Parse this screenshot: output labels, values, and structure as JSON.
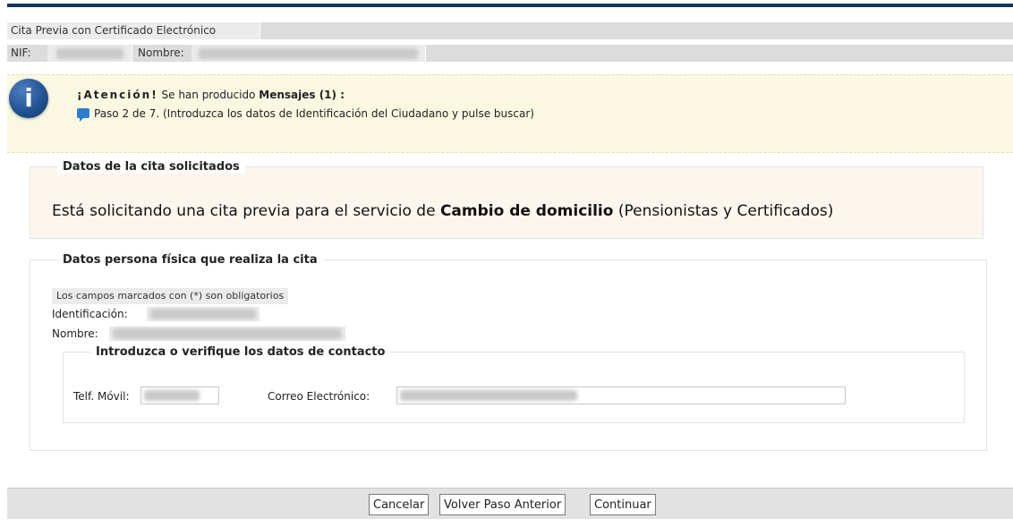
{
  "header": {
    "title": "Cita Previa con Certificado Electrónico",
    "nif_label": "NIF:",
    "nombre_label": "Nombre:"
  },
  "alert": {
    "icon": "info-icon",
    "heading": "¡Atención!",
    "produced_text": "Se han producido",
    "messages_label": "Mensajes (1) :",
    "message": "Paso 2 de 7. (Introduzca los datos de Identificación del Ciudadano y pulse buscar)"
  },
  "cita": {
    "legend": "Datos de la cita solicitados",
    "text_before": "Está solicitando una cita previa para el servicio de",
    "service": "Cambio de domicilio",
    "text_after": "(Pensionistas y Certificados)"
  },
  "persona": {
    "legend": "Datos persona física que realiza la cita",
    "required_note": "Los campos marcados con (*) son obligatorios",
    "identificacion_label": "Identificación:",
    "nombre_label": "Nombre:"
  },
  "contacto": {
    "legend": "Introduzca o verifique los datos de contacto",
    "movil_label": "Telf. Móvil:",
    "email_label": "Correo Electrónico:"
  },
  "buttons": {
    "cancel": "Cancelar",
    "back": "Volver Paso Anterior",
    "continue": "Continuar"
  },
  "colors": {
    "top_bar": "#14365f",
    "alert_bg": "#fbf8e2",
    "cita_bg": "#fdf6ef",
    "info_icon": "#1f4f8f"
  }
}
